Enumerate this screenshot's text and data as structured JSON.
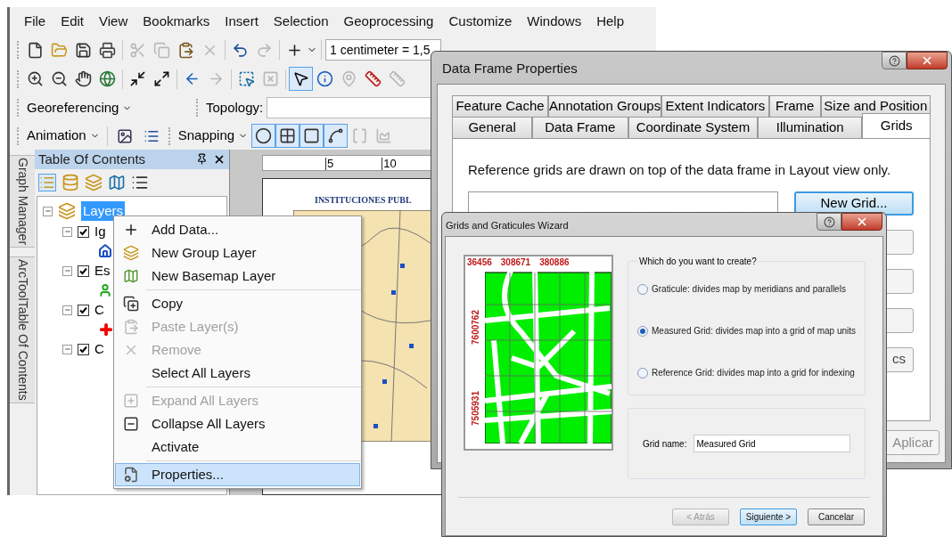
{
  "arcmap": {
    "menu": [
      "File",
      "Edit",
      "View",
      "Bookmarks",
      "Insert",
      "Selection",
      "Geoprocessing",
      "Customize",
      "Windows",
      "Help"
    ],
    "toolbar_standard": [
      [
        {
          "kind": "new",
          "disabled": false
        },
        {
          "kind": "open",
          "disabled": false
        },
        {
          "kind": "save",
          "disabled": false
        },
        {
          "kind": "print",
          "disabled": false
        }
      ],
      [
        {
          "kind": "cut",
          "disabled": true
        },
        {
          "kind": "copy",
          "disabled": true
        },
        {
          "kind": "paste",
          "disabled": false
        },
        {
          "kind": "delete",
          "disabled": true
        }
      ],
      [
        {
          "kind": "undo",
          "disabled": false
        },
        {
          "kind": "redo",
          "disabled": true
        }
      ],
      [
        {
          "kind": "add",
          "disabled": false
        }
      ]
    ],
    "scale": "1 centimeter = 1,5",
    "toolbar_tools": [
      [
        {
          "kind": "zoomin",
          "pressed": false,
          "disabled": false
        },
        {
          "kind": "zoomout",
          "pressed": false,
          "disabled": false
        },
        {
          "kind": "pan",
          "pressed": false,
          "disabled": false
        },
        {
          "kind": "globe",
          "pressed": false,
          "disabled": false
        }
      ],
      [
        {
          "kind": "shrink",
          "pressed": false,
          "disabled": false
        },
        {
          "kind": "expand",
          "pressed": false,
          "disabled": false
        }
      ],
      [
        {
          "kind": "back",
          "pressed": false,
          "disabled": false
        },
        {
          "kind": "forward",
          "pressed": false,
          "disabled": true
        }
      ],
      [
        {
          "kind": "selectbox",
          "pressed": false,
          "disabled": false
        },
        {
          "kind": "clear",
          "pressed": false,
          "disabled": true
        }
      ],
      [
        {
          "kind": "pointer",
          "pressed": true,
          "disabled": false
        },
        {
          "kind": "info",
          "pressed": false,
          "disabled": false
        },
        {
          "kind": "pin",
          "pressed": false,
          "disabled": true
        },
        {
          "kind": "measure",
          "pressed": false,
          "disabled": false
        },
        {
          "kind": "measure",
          "pressed": false,
          "disabled": true
        }
      ]
    ],
    "georeferencing": "Georeferencing",
    "topology": "Topology:",
    "animation": "Animation",
    "snapping": "Snapping",
    "snap_tools": [
      [
        {
          "kind": "circle",
          "pressed": true,
          "disabled": false
        },
        {
          "kind": "grid",
          "pressed": true,
          "disabled": false
        },
        {
          "kind": "square",
          "pressed": true,
          "disabled": false
        },
        {
          "kind": "edge",
          "pressed": true,
          "disabled": false
        },
        {
          "kind": "bracket",
          "pressed": false,
          "disabled": true
        },
        {
          "kind": "chart",
          "pressed": false,
          "disabled": true
        }
      ]
    ],
    "dock_tabs": [
      "Graph Manager",
      "ArcToolTable Of Contents"
    ],
    "toc": {
      "title": "Table Of Contents",
      "tree": {
        "label": "Layers",
        "selected": true,
        "expanded": true,
        "children": [
          {
            "label": "Ig",
            "checked": true,
            "expanded": true,
            "legend": {
              "kind": "building"
            }
          },
          {
            "label": "Es",
            "checked": true,
            "expanded": true,
            "legend": {
              "kind": "figure"
            }
          },
          {
            "label": "C",
            "checked": true,
            "expanded": true,
            "legend": {
              "kind": "cross"
            }
          },
          {
            "label": "C",
            "checked": true,
            "expanded": true
          }
        ]
      }
    },
    "layout": {
      "ruler": [
        "5",
        "10"
      ],
      "map_title": "INSTITUCIONES PUBL"
    }
  },
  "context_menu": {
    "groups": [
      [
        {
          "label": "Add Data...",
          "kind": "add",
          "disabled": false,
          "selected": false
        },
        {
          "label": "New Group Layer",
          "kind": "group",
          "disabled": false,
          "selected": false
        },
        {
          "label": "New Basemap Layer",
          "kind": "basemap",
          "disabled": false,
          "selected": false
        }
      ],
      [
        {
          "label": "Copy",
          "kind": "copy",
          "disabled": false,
          "selected": false
        },
        {
          "label": "Paste Layer(s)",
          "kind": "paste",
          "disabled": true,
          "selected": false
        },
        {
          "label": "Remove",
          "kind": "remove",
          "disabled": true,
          "selected": false
        },
        {
          "label": "Select All Layers",
          "kind": "none",
          "disabled": false,
          "selected": false
        }
      ],
      [
        {
          "label": "Expand All Layers",
          "kind": "expand",
          "disabled": true,
          "selected": false
        },
        {
          "label": "Collapse All Layers",
          "kind": "collapse",
          "disabled": false,
          "selected": false
        },
        {
          "label": "Activate",
          "kind": "none",
          "disabled": false,
          "selected": false
        }
      ],
      [
        {
          "label": "Properties...",
          "kind": "properties",
          "disabled": false,
          "selected": true
        }
      ]
    ]
  },
  "data_frame_properties": {
    "title": "Data Frame Properties",
    "tabs_back": [
      {
        "label": "Feature Cache",
        "selected": false
      },
      {
        "label": "Annotation Groups",
        "selected": false
      },
      {
        "label": "Extent Indicators",
        "selected": false
      },
      {
        "label": "Frame",
        "selected": false
      },
      {
        "label": "Size and Position",
        "selected": false
      }
    ],
    "tabs_front": [
      {
        "label": "General",
        "selected": false
      },
      {
        "label": "Data Frame",
        "selected": false
      },
      {
        "label": "Coordinate System",
        "selected": false
      },
      {
        "label": "Illumination",
        "selected": false
      },
      {
        "label": "Grids",
        "selected": true
      }
    ],
    "info": "Reference grids are drawn on top of the data frame in Layout view only.",
    "new_grid_button": "New Grid...",
    "side_button": "cs",
    "apply_button": "Aplicar"
  },
  "wizard": {
    "title": "Grids and Graticules Wizard",
    "preview": {
      "x_labels": [
        "36456",
        "308671",
        "380886"
      ],
      "y_labels": [
        "7600762",
        "7505931"
      ]
    },
    "question": "Which do you want to create?",
    "options": [
      {
        "label": "Graticule: divides map by meridians and parallels",
        "selected": false
      },
      {
        "label": "Measured Grid: divides map into a grid of map units",
        "selected": true
      },
      {
        "label": "Reference Grid: divides map into a grid for indexing",
        "selected": false
      }
    ],
    "grid_name_label": "Grid name:",
    "grid_name": "Measured Grid",
    "buttons": [
      {
        "label": "< Atrás",
        "disabled": true,
        "default": false
      },
      {
        "label": "Siguiente >",
        "disabled": false,
        "default": true
      },
      {
        "label": "Cancelar",
        "disabled": false,
        "default": false
      }
    ]
  }
}
